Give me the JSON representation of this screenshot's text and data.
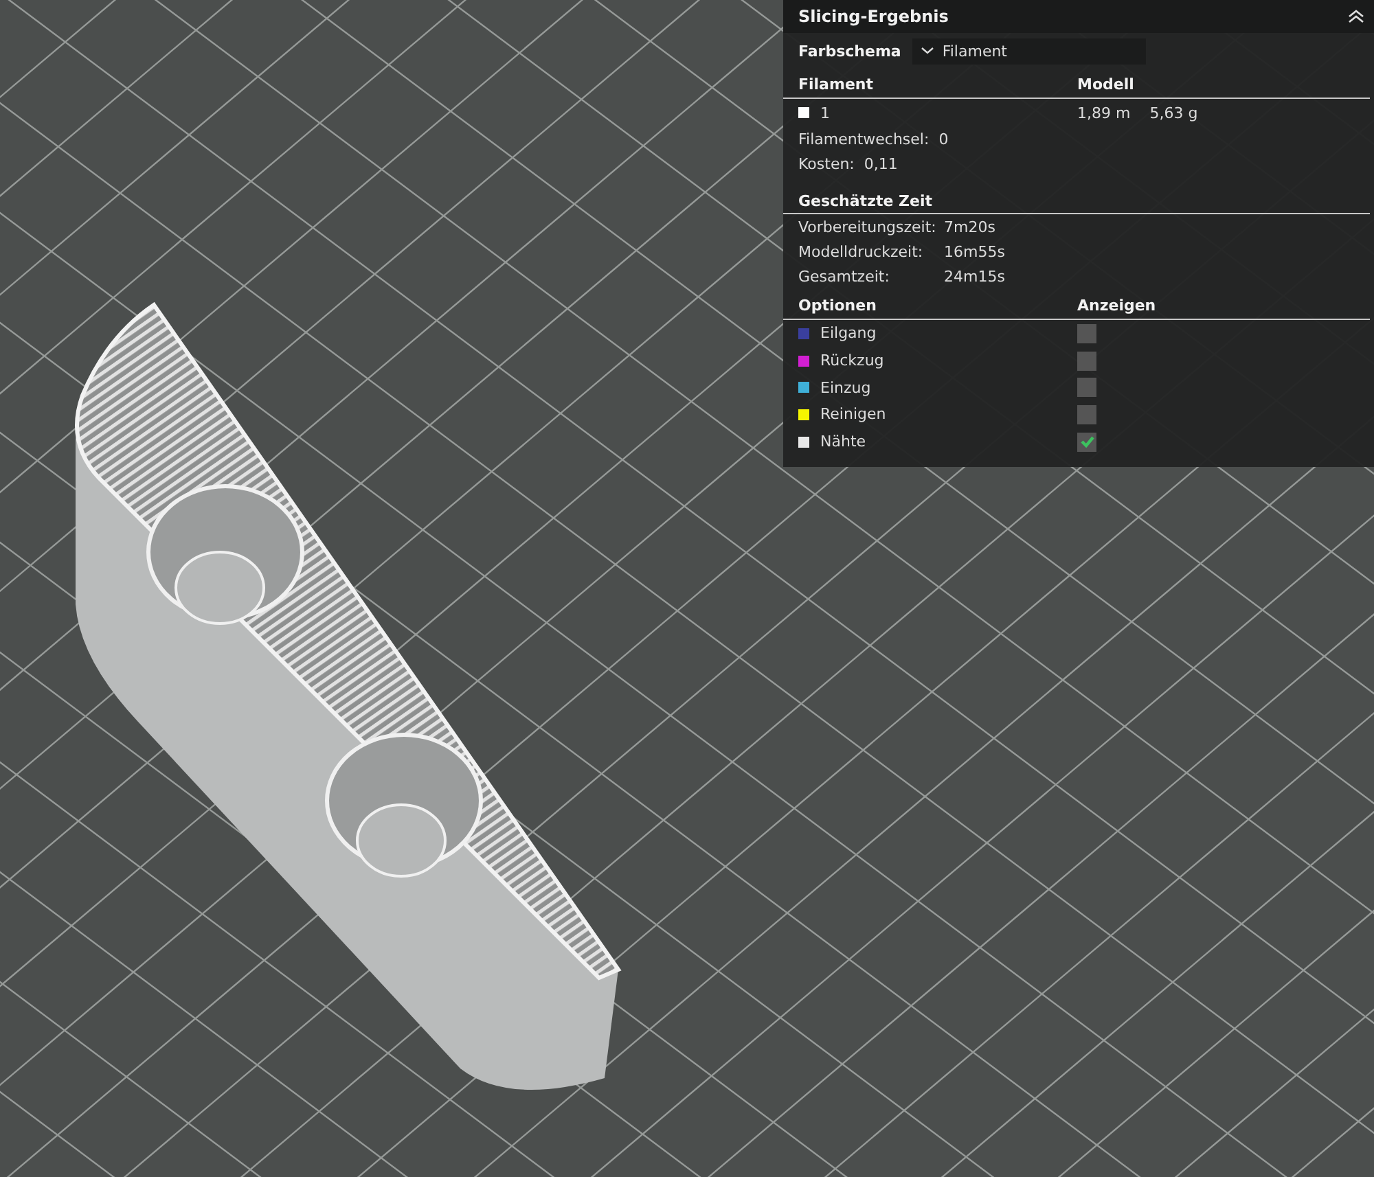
{
  "panel": {
    "title": "Slicing-Ergebnis",
    "color_scheme": {
      "label": "Farbschema",
      "value": "Filament"
    },
    "filament_table": {
      "columns": [
        "Filament",
        "Modell"
      ],
      "rows": [
        {
          "name": "1",
          "color": "#ffffff",
          "length": "1,89 m",
          "weight": "5,63 g"
        }
      ]
    },
    "stats": [
      {
        "label": "Filamentwechsel:",
        "value": "0"
      },
      {
        "label": "Kosten:",
        "value": "0,11"
      }
    ],
    "time": {
      "title": "Geschätzte Zeit",
      "rows": [
        {
          "label": "Vorbereitungszeit:",
          "value": "7m20s"
        },
        {
          "label": "Modelldruckzeit:",
          "value": "16m55s"
        },
        {
          "label": "Gesamtzeit:",
          "value": "24m15s"
        }
      ]
    },
    "options": {
      "columns": [
        "Optionen",
        "Anzeigen"
      ],
      "items": [
        {
          "label": "Eilgang",
          "color": "#3a3f9e",
          "checked": false
        },
        {
          "label": "Rückzug",
          "color": "#d21fd2",
          "checked": false
        },
        {
          "label": "Einzug",
          "color": "#3fb0d8",
          "checked": false
        },
        {
          "label": "Reinigen",
          "color": "#f5f500",
          "checked": false
        },
        {
          "label": "Nähte",
          "color": "#e8e8e8",
          "checked": true
        }
      ]
    }
  }
}
